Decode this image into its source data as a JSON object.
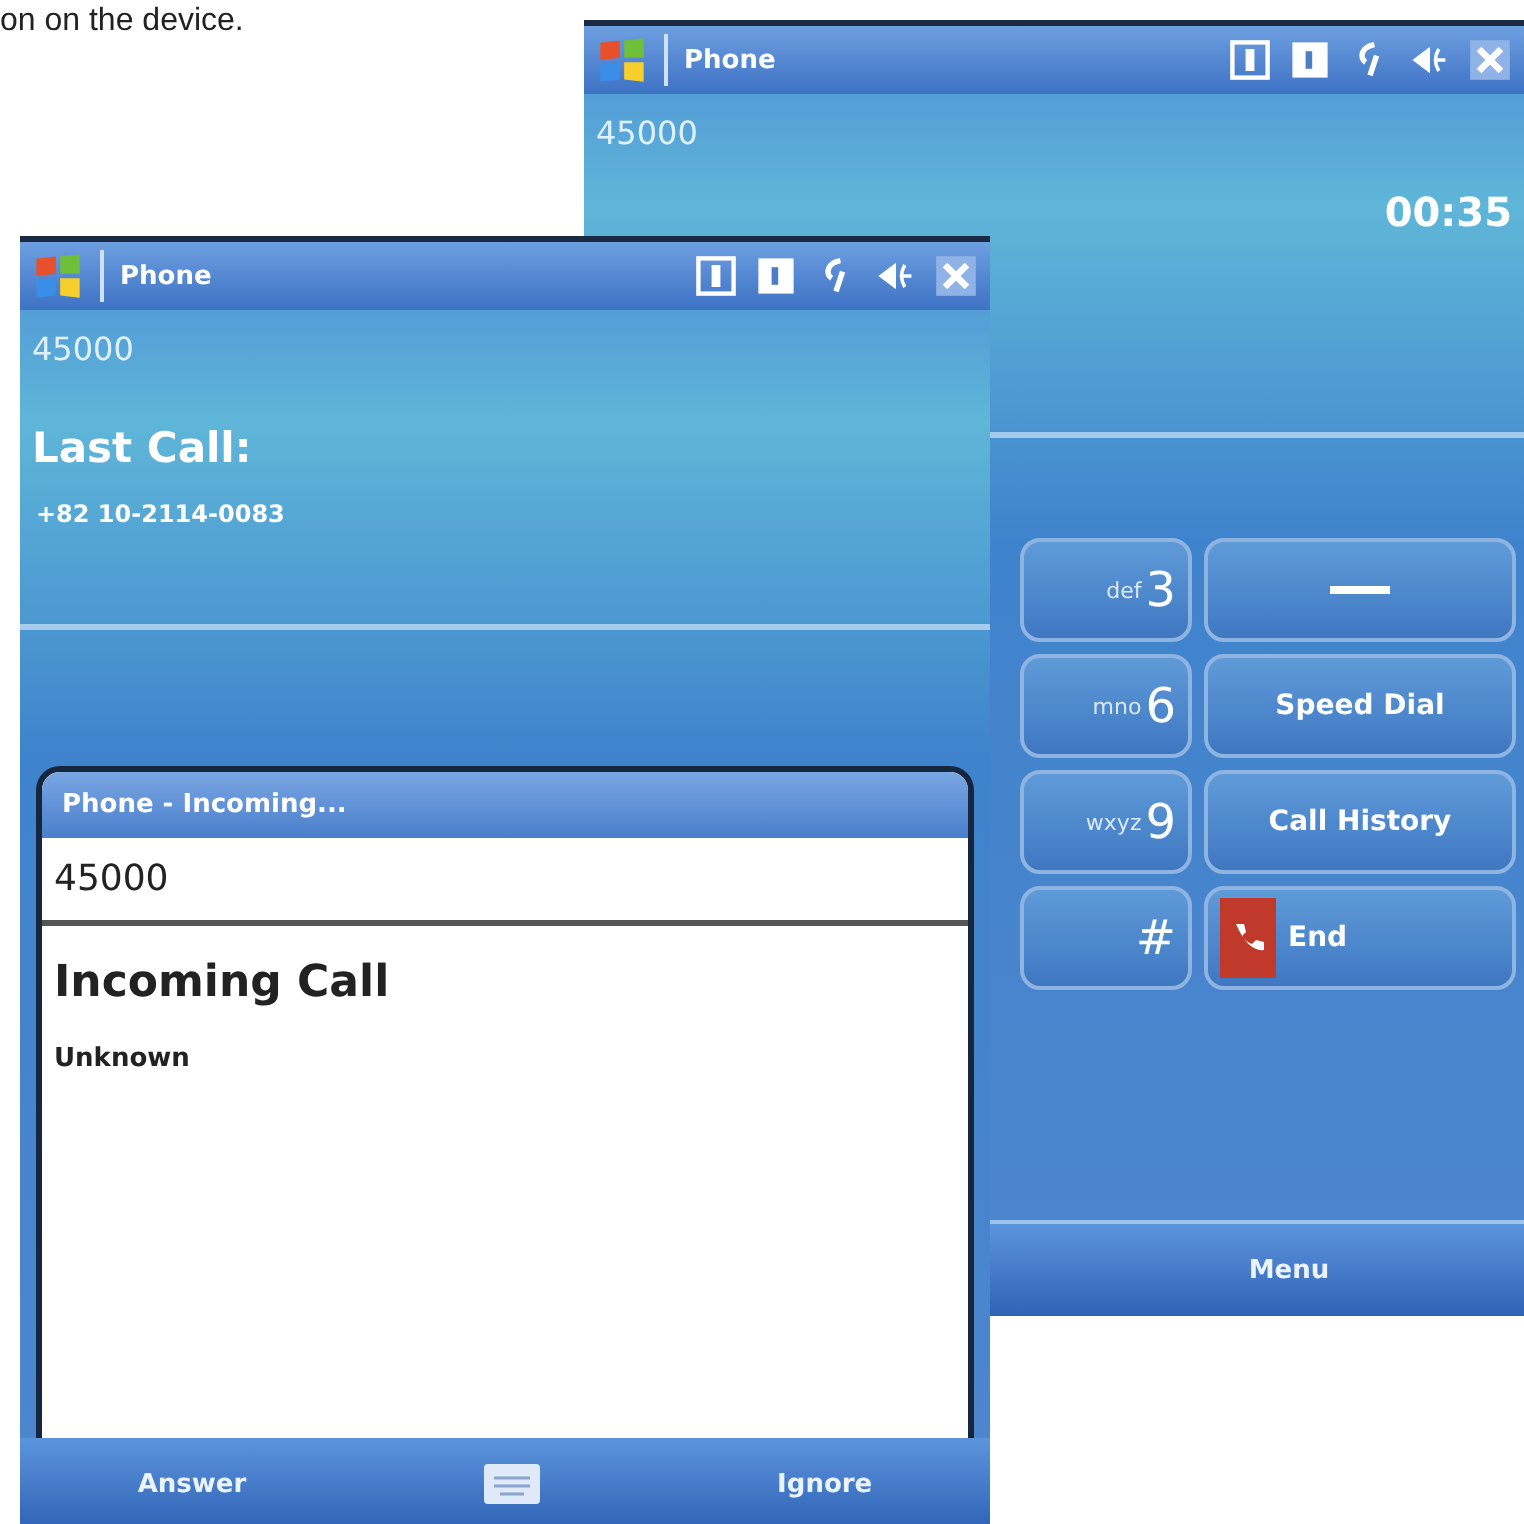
{
  "caption": "on on the device.",
  "back_screen": {
    "title": "Phone",
    "number": "45000",
    "timer": "00:35",
    "keypad": [
      {
        "kind": "digit",
        "letters": "def",
        "digit": "3"
      },
      {
        "kind": "backspace"
      },
      {
        "kind": "digit",
        "letters": "mno",
        "digit": "6"
      },
      {
        "kind": "label",
        "label": "Speed Dial"
      },
      {
        "kind": "digit",
        "letters": "wxyz",
        "digit": "9"
      },
      {
        "kind": "label",
        "label": "Call History"
      },
      {
        "kind": "digit",
        "digit": "#"
      },
      {
        "kind": "end",
        "label": "End"
      }
    ],
    "menu": "Menu"
  },
  "front_screen": {
    "title": "Phone",
    "number": "45000",
    "last_call_label": "Last Call:",
    "last_call_number": "+82 10-2114-0083",
    "dialog": {
      "title": "Phone - Incoming...",
      "number": "45000",
      "heading": "Incoming Call",
      "caller": "Unknown"
    },
    "left_softkey": "Answer",
    "right_softkey": "Ignore"
  }
}
